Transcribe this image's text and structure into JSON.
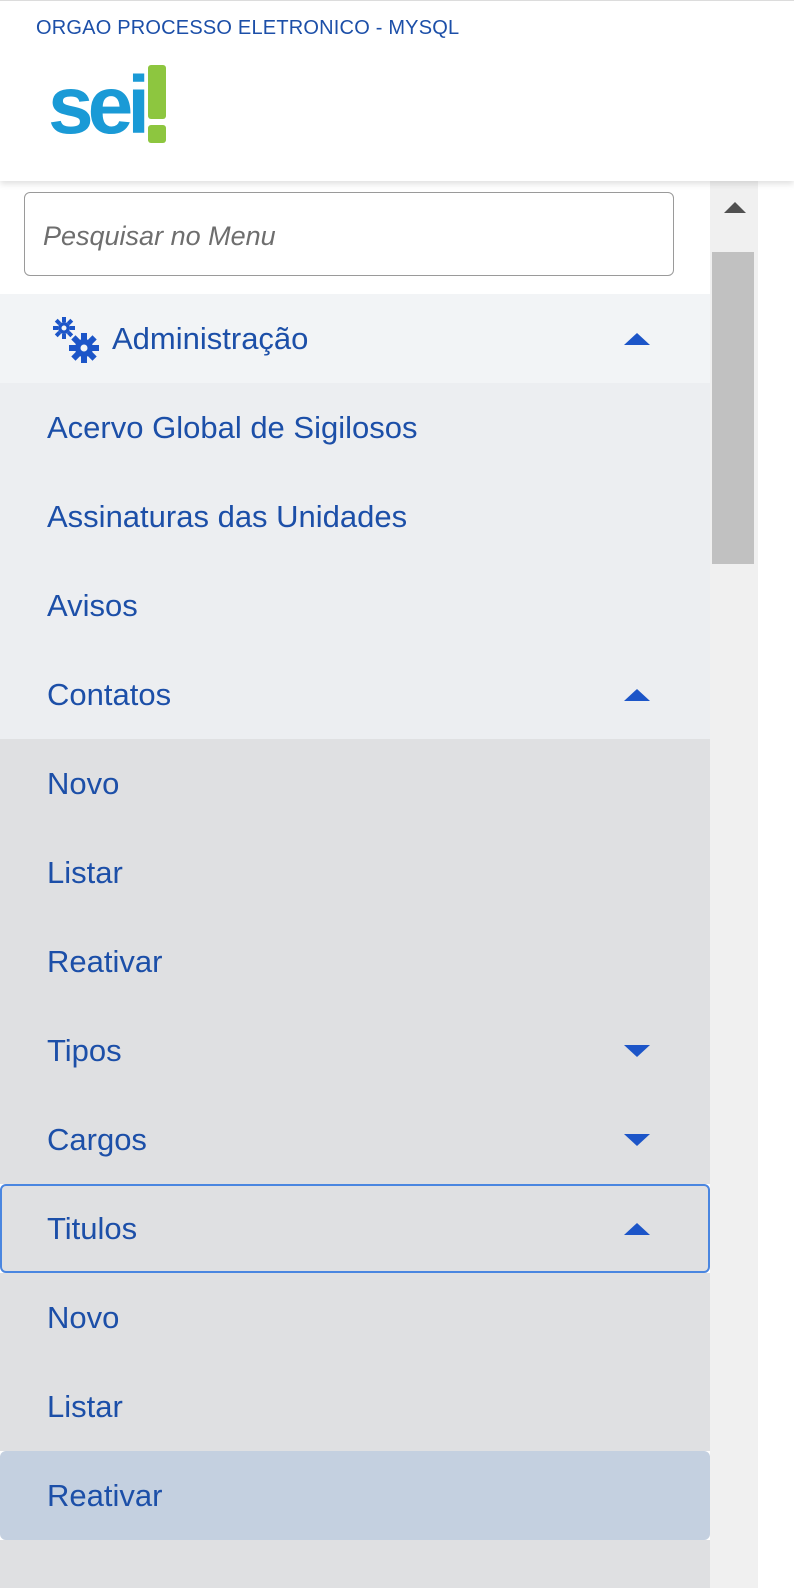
{
  "header": {
    "org_name": "ORGAO PROCESSO ELETRONICO - MYSQL",
    "logo_text": "sei",
    "logo_colors": {
      "text": "#1a9ad6",
      "mark": "#8dc63f"
    }
  },
  "search": {
    "placeholder": "Pesquisar no Menu",
    "value": ""
  },
  "menu": {
    "admin": {
      "label": "Administração",
      "icon": "gears-icon",
      "expanded": true
    },
    "items": [
      {
        "label": "Acervo Global de Sigilosos"
      },
      {
        "label": "Assinaturas das Unidades"
      },
      {
        "label": "Avisos"
      },
      {
        "label": "Contatos",
        "expanded": true
      },
      {
        "label": "Novo"
      },
      {
        "label": "Listar"
      },
      {
        "label": "Reativar"
      },
      {
        "label": "Tipos",
        "expanded": false
      },
      {
        "label": "Cargos",
        "expanded": false
      },
      {
        "label": "Titulos",
        "expanded": true
      },
      {
        "label": "Novo"
      },
      {
        "label": "Listar"
      },
      {
        "label": "Reativar",
        "selected": true
      }
    ]
  },
  "colors": {
    "accent": "#1c4fa8",
    "caret": "#1c55c8",
    "focus_border": "#4a86e0",
    "selected_bg": "#c4d0e0"
  }
}
